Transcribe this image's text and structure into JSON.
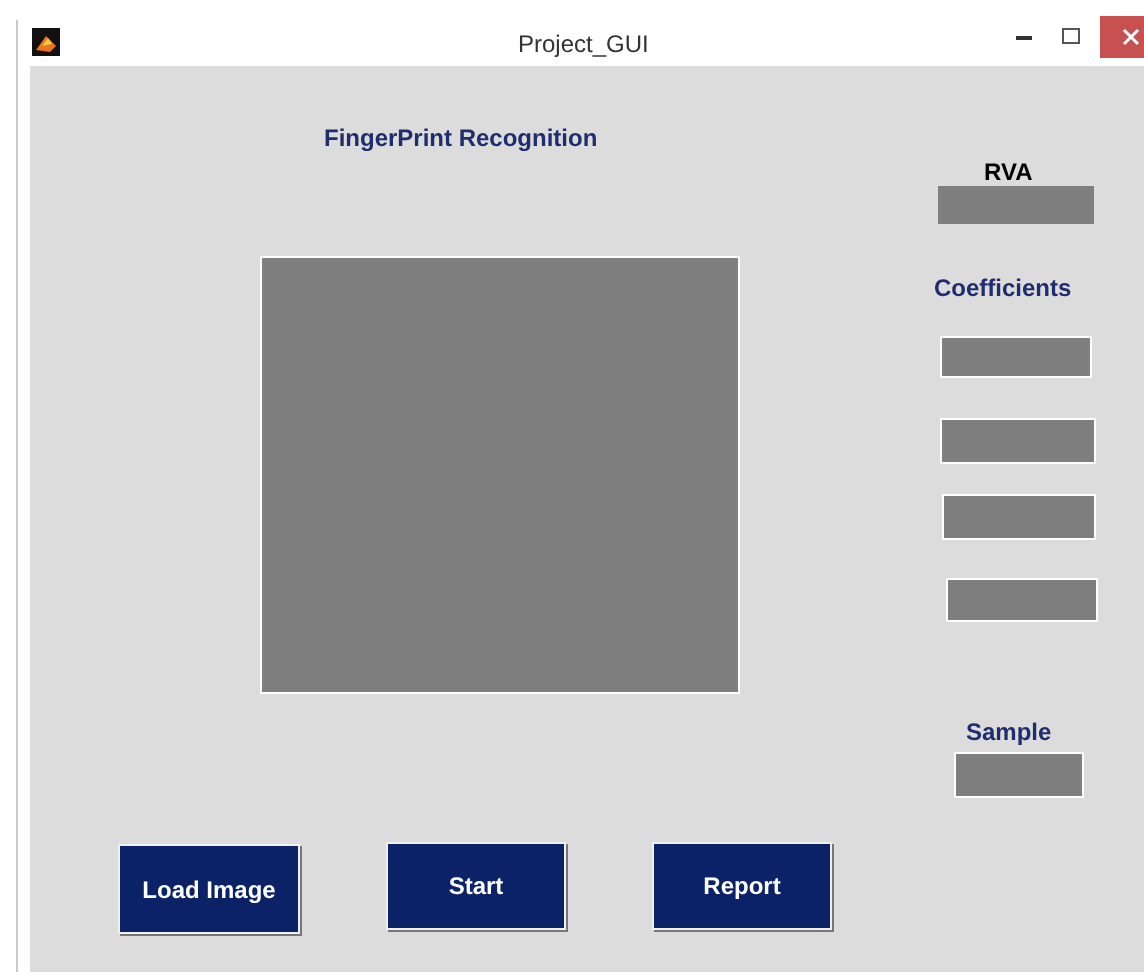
{
  "window": {
    "title": "Project_GUI"
  },
  "heading": "FingerPrint Recognition",
  "rva": {
    "label": "RVA"
  },
  "coefficients": {
    "label": "Coefficients",
    "fields": [
      {
        "kind": "blank"
      },
      {
        "kind": "blank"
      },
      {
        "kind": "blank"
      },
      {
        "kind": "blank"
      }
    ]
  },
  "sample": {
    "label": "Sample"
  },
  "buttons": [
    {
      "label": "Load Image"
    },
    {
      "label": "Start"
    },
    {
      "label": "Report"
    }
  ]
}
